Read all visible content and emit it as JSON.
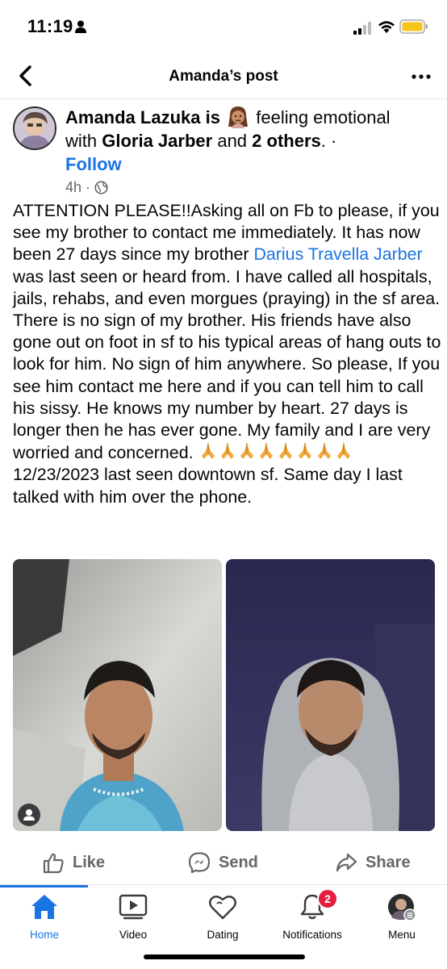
{
  "status_bar": {
    "time": "11:19"
  },
  "header": {
    "title": "Amanda’s post"
  },
  "post": {
    "author": "Amanda Lazuka",
    "is_word": "is",
    "feeling": "feeling emotional",
    "with_word": "with",
    "tagged": "Gloria Jarber",
    "and_word": "and",
    "others": "2 others",
    "dot": ". ·",
    "follow_label": "Follow",
    "time_ago": "4h",
    "meta_sep": "·",
    "body_1": "ATTENTION PLEASE!!Asking all on Fb to please, if you see my brother to contact me immediately. It has now been 27 days since my brother ",
    "mention": "Darius Travella Jarber",
    "body_2": " was last seen or heard from. I have called all hospitals, jails, rehabs, and even morgues (praying) in the sf area. There is no sign of my brother. His friends have also gone out on foot in sf to his typical areas of hang outs to look for him. No sign of him anywhere. So please, If you see him contact me here and if you can tell him to call his sissy. He knows my number by heart. 27 days is longer then he has ever gone. My family and I are very worried and concerned. ",
    "body_3": " 12/23/2023 last seen downtown sf. Same day I last talked with him over the phone."
  },
  "actions": {
    "like": "Like",
    "send": "Send",
    "share": "Share"
  },
  "tabs": [
    {
      "label": "Home"
    },
    {
      "label": "Video"
    },
    {
      "label": "Dating"
    },
    {
      "label": "Notifications",
      "badge": "2"
    },
    {
      "label": "Menu"
    }
  ],
  "colors": {
    "accent": "#1b74e4",
    "badge": "#e41e3f",
    "muted": "#65676b"
  },
  "icons": [
    "person-icon",
    "signal-icon",
    "wifi-icon",
    "battery-icon",
    "back-icon",
    "more-icon",
    "globe-icon",
    "praying-hands-icon",
    "thumbs-up-icon",
    "messenger-icon",
    "share-arrow-icon",
    "home-icon",
    "video-icon",
    "dating-heart-icon",
    "bell-icon"
  ]
}
